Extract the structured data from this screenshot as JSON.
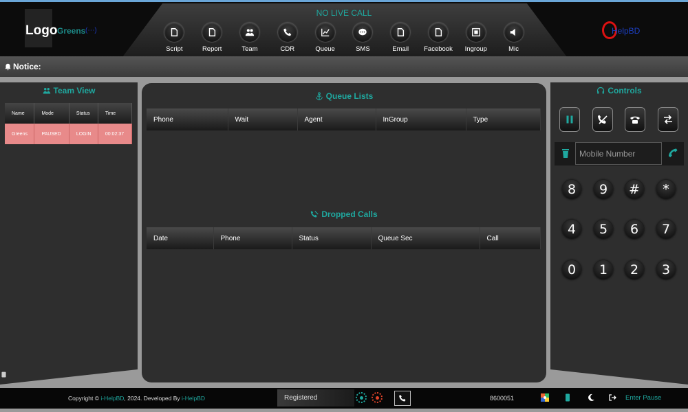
{
  "header": {
    "logo_text": "Logo",
    "user_name": "Greens",
    "user_tag": "(⋯)",
    "live_status": "NO LIVE CALL",
    "brand": "HelpBD",
    "nav": [
      {
        "label": "Script",
        "icon": "file-icon"
      },
      {
        "label": "Report",
        "icon": "file-icon"
      },
      {
        "label": "Team",
        "icon": "users-icon"
      },
      {
        "label": "CDR",
        "icon": "phone-icon"
      },
      {
        "label": "Queue",
        "icon": "chart-icon"
      },
      {
        "label": "SMS",
        "icon": "chat-icon"
      },
      {
        "label": "Email",
        "icon": "file-icon"
      },
      {
        "label": "Facebook",
        "icon": "file-icon"
      },
      {
        "label": "Ingroup",
        "icon": "grid-icon"
      },
      {
        "label": "Mic",
        "icon": "speaker-icon"
      }
    ]
  },
  "notice": {
    "label": "Notice:"
  },
  "team_view": {
    "title": "Team View",
    "columns": [
      "Name",
      "Mode",
      "Status",
      "Time"
    ],
    "rows": [
      [
        "Greens",
        "PAUSED",
        "LOGIN",
        "00:02:37"
      ]
    ]
  },
  "queue_lists": {
    "title": "Queue Lists",
    "columns": [
      "Phone",
      "Wait",
      "Agent",
      "InGroup",
      "Type"
    ]
  },
  "dropped_calls": {
    "title": "Dropped Calls",
    "columns": [
      "Date",
      "Phone",
      "Status",
      "Queue Sec",
      "Call"
    ]
  },
  "controls": {
    "title": "Controls",
    "buttons": [
      "pause-icon",
      "call-end-icon",
      "hold-phone-icon",
      "transfer-icon"
    ],
    "input_placeholder": "Mobile Number",
    "keypad": [
      [
        "8",
        "9",
        "#",
        "*"
      ],
      [
        "4",
        "5",
        "6",
        "7"
      ],
      [
        "0",
        "1",
        "2",
        "3"
      ]
    ]
  },
  "footer": {
    "copyright": "Copyright © ",
    "company_link": "i-HelpBD",
    "copyright_mid": ", 2024. Developed By ",
    "developer_link": "i-HelpBD",
    "status": "Registered",
    "extension": "8600051",
    "enter_pause": "Enter Pause"
  },
  "colors": {
    "accent": "#1fa89f",
    "row_highlight": "#e88a8a",
    "panel": "#2e2e2e"
  }
}
